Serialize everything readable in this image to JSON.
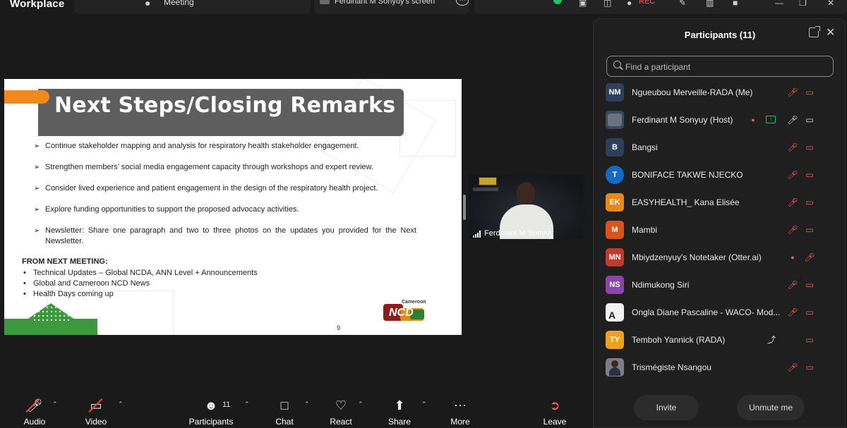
{
  "app": {
    "title": "Workplace",
    "meeting_label": "Meeting",
    "screen_label": "Ferdinant M Sonyuy's screen",
    "rec_label": "REC"
  },
  "slide": {
    "title": "Next Steps/Closing Remarks",
    "bullets": [
      "Continue stakeholder mapping and analysis for respiratory health stakeholder engagement.",
      "Strengthen members’ social media engagement capacity through workshops and expert review.",
      "Consider lived experience and patient engagement in the design of the respiratory health project.",
      "Explore funding opportunities to support the proposed advocacy activities.",
      "Newsletter: Share one paragraph and two to three photos on the updates you provided for the Next Newsletter."
    ],
    "from_next_heading": "FROM NEXT MEETING:",
    "from_next_items": [
      "Technical Updates – Global NCDA, ANN Level + Announcements",
      "Global and Cameroon NCD News",
      "Health Days coming up"
    ],
    "logo_top": "Cameroon",
    "logo_text": "NCD",
    "page_number": "9"
  },
  "video_tile": {
    "name": "Ferdinant M Sonyuy"
  },
  "participants_panel": {
    "title": "Participants (11)",
    "search_placeholder": "Find a participant",
    "participants": [
      {
        "initials": "NM",
        "name": "Ngueubou Merveille-RADA (Me)",
        "avatar_color": "#2d3f5a",
        "mic": "off",
        "cam": "off"
      },
      {
        "initials": "",
        "name": "Ferdinant M Sonyuy (Host)",
        "avatar_color": "#3a4a63",
        "mic": "on",
        "cam": "on",
        "recording": true,
        "sharing": true
      },
      {
        "initials": "B",
        "name": "Bangsi",
        "avatar_color": "#2d3f5a",
        "mic": "off",
        "cam": "off"
      },
      {
        "initials": "T",
        "name": "BONIFACE TAKWE NJECKO",
        "avatar_color": "#1769c7",
        "mic": "off",
        "cam": "off"
      },
      {
        "initials": "EK",
        "name": "EASYHEALTH_ Kana Elisée",
        "avatar_color": "#e58a17",
        "mic": "off",
        "cam": "off"
      },
      {
        "initials": "M",
        "name": "Mambi",
        "avatar_color": "#d9541b",
        "mic": "off",
        "cam": "off"
      },
      {
        "initials": "MN",
        "name": "Mbiydzenyuy's Notetaker (Otter.ai)",
        "avatar_color": "#c2392f",
        "mic": "off",
        "recording": true
      },
      {
        "initials": "NS",
        "name": "Ndimukong Siri",
        "avatar_color": "#8e44ad",
        "mic": "off",
        "cam": "off"
      },
      {
        "initials": "",
        "name": "Ongla Diane Pascaline - WACO- Mod...",
        "avatar_color": "#f2f2f2",
        "mic": "off",
        "cam": "off"
      },
      {
        "initials": "TY",
        "name": "Temboh Yannick (RADA)",
        "avatar_color": "#f0a020",
        "mic": "muted_by_host",
        "cam": "off"
      },
      {
        "initials": "",
        "name": "Trismégiste Nsangou",
        "avatar_color": "#7a7f8a",
        "mic": "off",
        "cam": "off"
      }
    ],
    "invite_label": "Invite",
    "unmute_label": "Unmute me"
  },
  "toolbar": {
    "audio": "Audio",
    "video": "Video",
    "participants": "Participants",
    "participants_count": "11",
    "chat": "Chat",
    "react": "React",
    "share": "Share",
    "more": "More",
    "leave": "Leave"
  },
  "colors": {
    "accent_green": "#19c26b",
    "alert_red": "#ff5b5b",
    "slide_orange": "#f08a1c",
    "slide_green": "#3c9a3d"
  }
}
